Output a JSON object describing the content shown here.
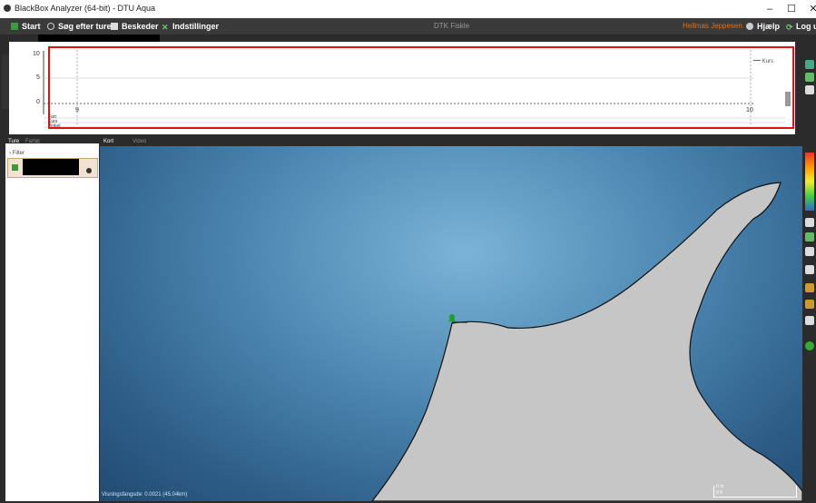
{
  "window": {
    "title": "BlackBox Analyzer (64-bit) - DTU Aqua",
    "minimize": "–",
    "maximize": "☐",
    "close": "✕"
  },
  "menu": {
    "start": "Start",
    "search": "Søg efter ture",
    "messages": "Beskeder",
    "settings": "Indstillinger",
    "center_label": "DTK Fiskle",
    "user": "Hellmas Jeppesen",
    "help": "Hjælp",
    "logout": "Log ud"
  },
  "chart": {
    "y_ticks": [
      "10",
      "5",
      "0"
    ],
    "x_ticks": [
      "9",
      "10"
    ],
    "legend": "Kurs",
    "track_labels": [
      "Fart",
      "Kurs",
      "Vinkel"
    ]
  },
  "left_panel": {
    "tabs": [
      "Ture",
      "Fartøj"
    ],
    "filter_label": "Filter"
  },
  "map": {
    "tabs": [
      "Kort",
      "Video"
    ],
    "status": "Visningsfangsde: 0.0021 (45.04km)",
    "scale_top": "0 m",
    "scale_bottom": "0 ft"
  },
  "colors": {
    "accent_red": "#e01010",
    "menu_bg": "#3a3a3a",
    "land": "#c6c6c6",
    "marker": "#1f9c2f"
  }
}
